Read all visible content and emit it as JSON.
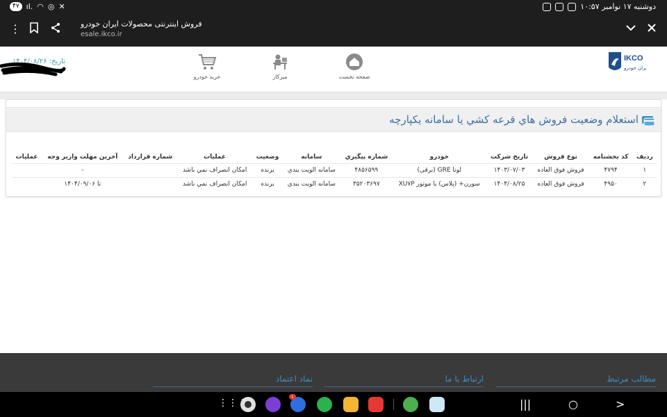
{
  "status_bar": {
    "datetime": "دوشنبه ۱۷ نوامبر ۱۰:۵۷",
    "battery": "۴۷",
    "signal": "ıl."
  },
  "browser": {
    "page_title": "فروش اینترنتی محصولات ایران خودرو",
    "url": "esale.ikco.ir",
    "icons": [
      "close-icon",
      "chevron-down-icon",
      "share-icon",
      "bookmark-icon",
      "more-vert-icon"
    ]
  },
  "header": {
    "logo_text": "IKCO",
    "logo_subtext": "ایران خودرو",
    "nav": [
      {
        "label": "صفحه نخست",
        "icon": "home-icon"
      },
      {
        "label": "ميزكار",
        "icon": "desk-icon"
      },
      {
        "label": "خريد خودرو",
        "icon": "cart-icon"
      }
    ],
    "date_label": "تاریخ: ۱۴۰۴/۰۸/۲۶"
  },
  "panel": {
    "title": "استعلام وضعيت فروش هاي قرعه كشي يا سامانه يكپارچه",
    "columns": [
      "رديف",
      "كد بخشنامه",
      "نوع فروش",
      "تاريخ شركت",
      "خودرو",
      "شماره پيگيري",
      "سامانه",
      "وضعيت",
      "عمليات",
      "شماره قرارداد",
      "آخرين مهلت واريز وجه",
      "عمليات"
    ],
    "rows": [
      [
        "۱",
        "۴۷۹۴",
        "فروش فوق العاده",
        "۱۴۰۳/۰۷/۰۳",
        "لونا GRE (برقی)",
        "۴۸۵۶۵۹۹",
        "سامانه الويت بندي",
        "برنده",
        "امكان انصراف نمي باشد",
        "",
        "-",
        ""
      ],
      [
        "۲",
        "۴۹۵۰",
        "فروش فوق العاده",
        "۱۴۰۴/۰۸/۲۵",
        "سورن+ (پلاس) با موتور XU۷P",
        "۳۵۲۰۳۶۹۷",
        "سامانه الويت بندي",
        "برنده",
        "امكان انصراف نمي باشد",
        "",
        "تا ۱۴۰۴/۰۹/۰۶",
        ""
      ]
    ]
  },
  "footer": {
    "links": [
      "مطالب مرتبط",
      "ارتباط با ما",
      "نماد اعتماد"
    ]
  },
  "navbar": {
    "apps": [
      "camera-app-icon",
      "browser-app-icon",
      "messages-app-icon",
      "phone-app-icon",
      "files-app-icon",
      "flipboard-app-icon",
      "games-app-icon",
      "app-icon"
    ],
    "badge": "۱"
  }
}
